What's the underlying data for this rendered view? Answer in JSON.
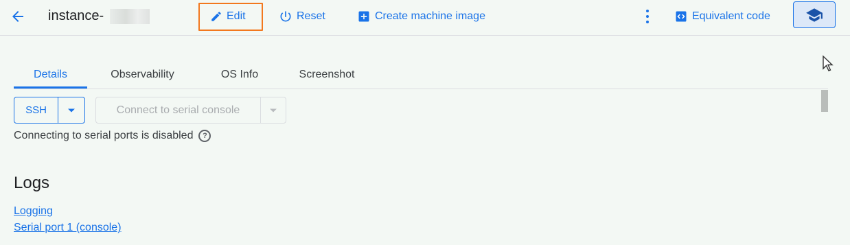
{
  "header": {
    "title": "instance-",
    "buttons": {
      "edit": "Edit",
      "reset": "Reset",
      "create_machine_image": "Create machine image",
      "equivalent_code": "Equivalent code"
    }
  },
  "tabs": [
    "Details",
    "Observability",
    "OS Info",
    "Screenshot"
  ],
  "active_tab": "Details",
  "connect": {
    "ssh_label": "SSH",
    "serial_label": "Connect to serial console",
    "serial_note": "Connecting to serial ports is disabled",
    "help_symbol": "?"
  },
  "logs": {
    "heading": "Logs",
    "links": [
      "Logging",
      "Serial port 1 (console)"
    ]
  },
  "colors": {
    "accent": "#1a73e8",
    "highlight": "#f2781e",
    "background": "#f3f8f4"
  }
}
